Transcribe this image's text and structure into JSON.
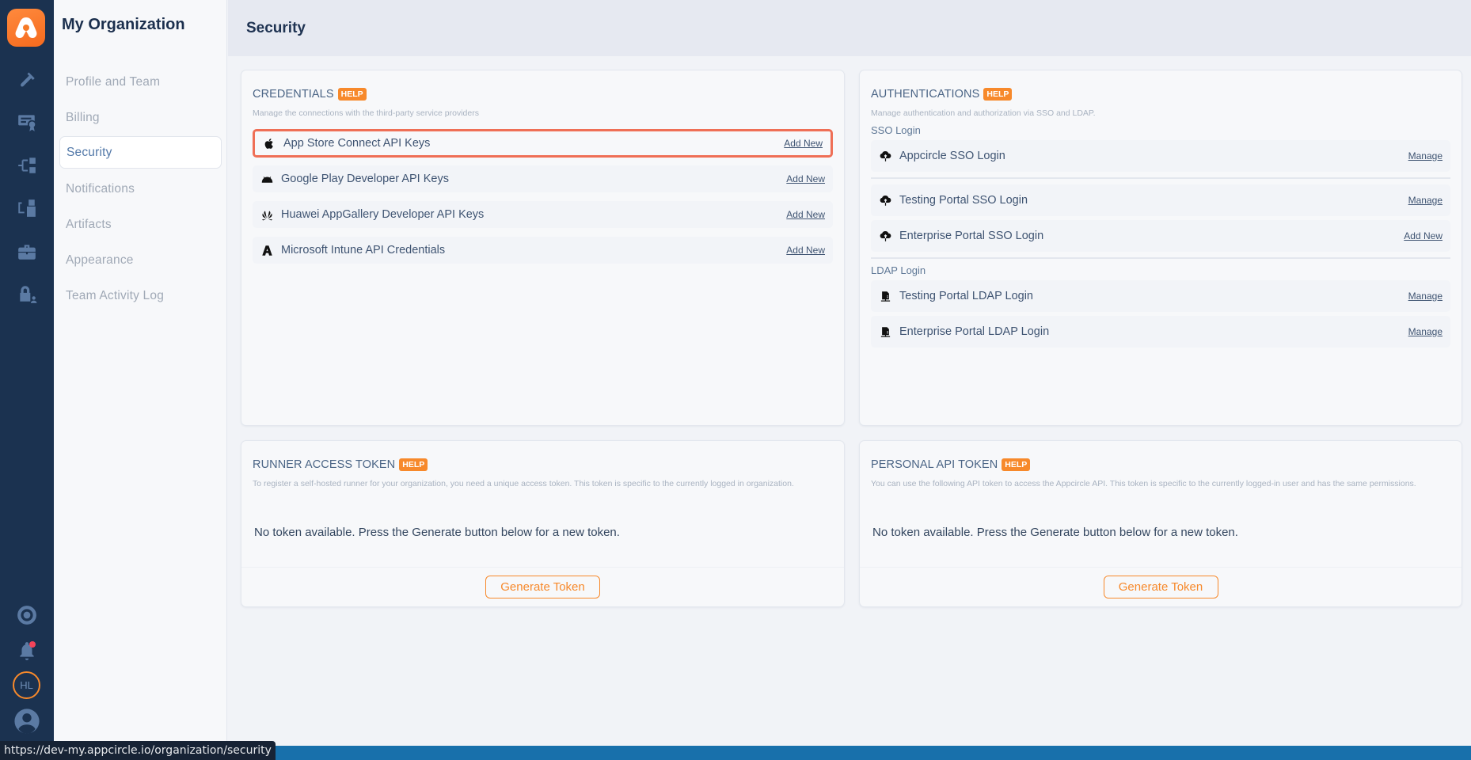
{
  "app": {
    "org_title": "My Organization",
    "page_title": "Security",
    "status_url": "https://dev-my.appcircle.io/organization/security",
    "avatar_initials": "HL",
    "colors": {
      "rail": "#1b3250",
      "accent": "#f7892b",
      "highlight_border": "#ef6f56",
      "status_bar": "#1870ab",
      "notification_dot": "#f5445a"
    }
  },
  "rail": {
    "icons": [
      {
        "name": "build-hammer-icon"
      },
      {
        "name": "signing-certificate-icon"
      },
      {
        "name": "distribution-icon"
      },
      {
        "name": "testing-distribution-icon"
      },
      {
        "name": "enterprise-store-icon"
      },
      {
        "name": "organization-lock-icon"
      }
    ],
    "bottom_icons": [
      {
        "name": "help-support-icon"
      },
      {
        "name": "notifications-bell-icon",
        "has_notification": true
      },
      {
        "name": "user-avatar-icon"
      }
    ]
  },
  "subnav": {
    "items": [
      {
        "label": "Profile and Team",
        "active": false
      },
      {
        "label": "Billing",
        "active": false
      },
      {
        "label": "Security",
        "active": true
      },
      {
        "label": "Notifications",
        "active": false
      },
      {
        "label": "Artifacts",
        "active": false
      },
      {
        "label": "Appearance",
        "active": false
      },
      {
        "label": "Team Activity Log",
        "active": false
      }
    ]
  },
  "credentials": {
    "title": "CREDENTIALS",
    "help": "HELP",
    "description": "Manage the connections with the third-party service providers",
    "items": [
      {
        "label": "App Store Connect API Keys",
        "icon": "apple-icon",
        "action": "Add New",
        "highlighted": true
      },
      {
        "label": "Google Play Developer API Keys",
        "icon": "android-icon",
        "action": "Add New",
        "highlighted": false
      },
      {
        "label": "Huawei AppGallery Developer API Keys",
        "icon": "huawei-icon",
        "action": "Add New",
        "highlighted": false
      },
      {
        "label": "Microsoft Intune API Credentials",
        "icon": "intune-icon",
        "action": "Add New",
        "highlighted": false
      }
    ]
  },
  "authentications": {
    "title": "AUTHENTICATIONS",
    "help": "HELP",
    "description": "Manage authentication and authorization via SSO and LDAP.",
    "sso_label": "SSO Login",
    "sso_items": [
      {
        "label": "Appcircle SSO Login",
        "icon": "cloud-key-icon",
        "action": "Manage"
      },
      {
        "label": "Testing Portal SSO Login",
        "icon": "cloud-key-icon",
        "action": "Manage"
      },
      {
        "label": "Enterprise Portal SSO Login",
        "icon": "cloud-key-icon",
        "action": "Add New"
      }
    ],
    "ldap_label": "LDAP Login",
    "ldap_items": [
      {
        "label": "Testing Portal LDAP Login",
        "icon": "server-network-icon",
        "action": "Manage"
      },
      {
        "label": "Enterprise Portal LDAP Login",
        "icon": "server-network-icon",
        "action": "Manage"
      }
    ]
  },
  "runner_token": {
    "title": "RUNNER ACCESS TOKEN",
    "help": "HELP",
    "description": "To register a self-hosted runner for your organization, you need a unique access token. This token is specific to the currently logged in organization.",
    "empty_message": "No token available. Press the Generate button below for a new token.",
    "button": "Generate Token"
  },
  "personal_token": {
    "title": "PERSONAL API TOKEN",
    "help": "HELP",
    "description": "You can use the following API token to access the Appcircle API. This token is specific to the currently logged-in user and has the same permissions.",
    "empty_message": "No token available. Press the Generate button below for a new token.",
    "button": "Generate Token"
  }
}
